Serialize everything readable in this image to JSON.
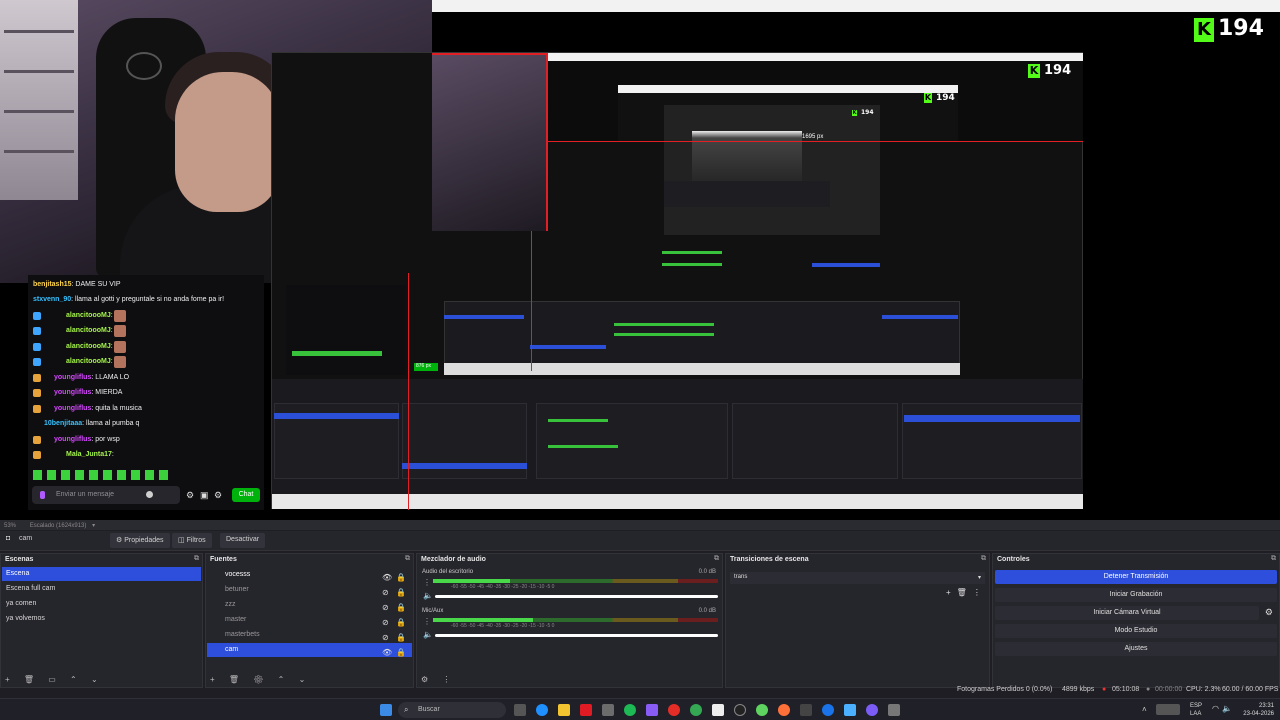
{
  "overlay": {
    "viewer_count": "194",
    "nested_counter_1": "194",
    "nested_counter_2": "194",
    "nested_counter_3": "194",
    "px_label_1": "1695 px",
    "px_label_2": "876 px"
  },
  "chat": {
    "messages": [
      {
        "user": "benjitash15",
        "text": ": DAME SU VIP",
        "color": "#ffd54a"
      },
      {
        "user": "stxvenn_90",
        "text": ": llama al gotti y preguntale si no anda fome pa ir!",
        "color": "#37c1ff"
      },
      {
        "user": "alancitoooMJ",
        "text": ":",
        "color": "#a5f34b"
      },
      {
        "user": "alancitoooMJ",
        "text": ":",
        "color": "#a5f34b"
      },
      {
        "user": "alancitoooMJ",
        "text": ":",
        "color": "#a5f34b"
      },
      {
        "user": "alancitoooMJ",
        "text": ":",
        "color": "#a5f34b"
      },
      {
        "user": "youngliflus",
        "text": ": LLAMA LO",
        "color": "#d646ff"
      },
      {
        "user": "youngliflus",
        "text": ": MIERDA",
        "color": "#d646ff"
      },
      {
        "user": "youngliflus",
        "text": ": quita la musica",
        "color": "#d646ff"
      },
      {
        "user": "10benjitaaa",
        "text": ": llama al pumba q",
        "color": "#37c1ff"
      },
      {
        "user": "youngliflus",
        "text": ": por wsp",
        "color": "#d646ff"
      },
      {
        "user": "Mala_Junta17",
        "text": ":",
        "color": "#a5f34b"
      }
    ],
    "input_placeholder": "Enviar un mensaje",
    "send_label": "Chat"
  },
  "obs": {
    "zoom_label": "53%",
    "scale_label": "Escalado (1624x913)",
    "source_name": "cam",
    "toolbar": {
      "properties": "Propiedades",
      "filters": "Filtros",
      "deactivate": "Desactivar"
    },
    "scenes": {
      "title": "Escenas",
      "items": [
        "Escena",
        "Escena full cam",
        "ya comen",
        "ya volvemos"
      ],
      "selected": 0
    },
    "sources": {
      "title": "Fuentes",
      "items": [
        "vocesss",
        "betuner",
        "zzz",
        "master",
        "masterbets",
        "cam"
      ],
      "selected": 5
    },
    "mixer": {
      "title": "Mezclador de audio",
      "channels": [
        {
          "name": "Audio del escritorio",
          "db": "0.0 dB",
          "level": 0.27
        },
        {
          "name": "Mic/Aux",
          "db": "0.0 dB",
          "level": 0.35
        }
      ],
      "ticks": "-60  -55  -50  -45  -40  -35  -30  -25  -20  -15  -10  -5  0"
    },
    "transitions": {
      "title": "Transiciones de escena",
      "selected": "trans"
    },
    "controls": {
      "title": "Controles",
      "buttons": [
        "Detener Transmisión",
        "Iniciar Grabación",
        "Iniciar Cámara Virtual",
        "Modo Estudio",
        "Ajustes"
      ]
    },
    "status": {
      "frames_lost": "Fotogramas Perdidos 0 (0.0%)",
      "bitrate": "4899 kbps",
      "live_time": "05:10:08",
      "rec_time": "00:00:00",
      "cpu": "CPU: 2.3%",
      "fps": "60.00 / 60.00 FPS"
    }
  },
  "taskbar": {
    "search_placeholder": "Buscar",
    "lang_1": "ESP",
    "lang_2": "LAA",
    "time": "23:31",
    "date": "23-04-2026"
  },
  "colors": {
    "accent_blue": "#2d4fdc",
    "kick_green": "#53fc18",
    "twitch_send": "#00b30c"
  }
}
